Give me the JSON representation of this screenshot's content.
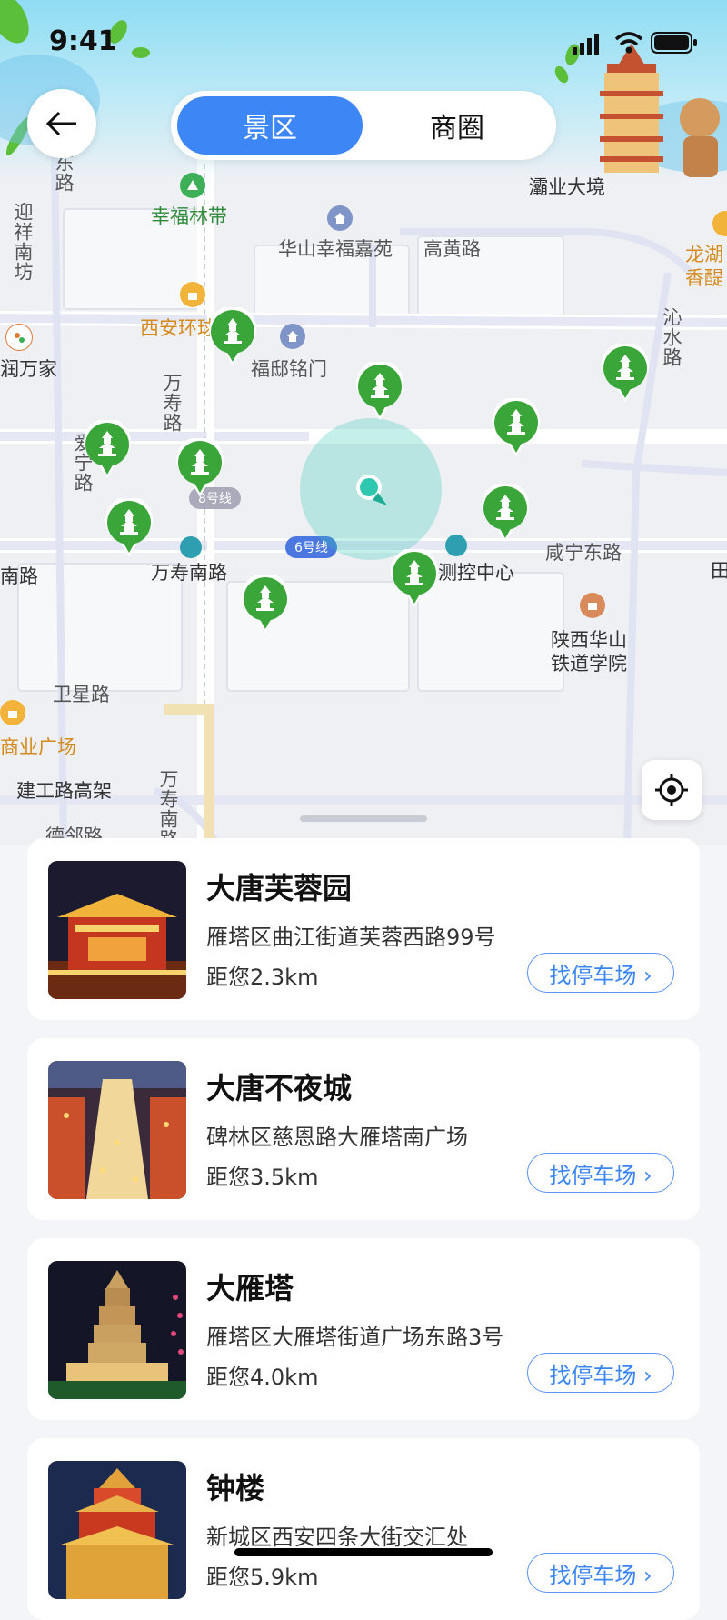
{
  "status": {
    "time": "9:41"
  },
  "tabs": {
    "active": "景区",
    "inactive": "商圈"
  },
  "map": {
    "labels": [
      {
        "text": "幸福林带",
        "cls": "green"
      },
      {
        "text": "华山幸福嘉苑",
        "cls": ""
      },
      {
        "text": "高黄路",
        "cls": ""
      },
      {
        "text": "灞业大境",
        "cls": "dark"
      },
      {
        "text": "龙湖",
        "cls": "orange"
      },
      {
        "text": "香醍",
        "cls": "orange"
      },
      {
        "text": "西安环球",
        "cls": "orange"
      },
      {
        "text": "福邸铭门",
        "cls": ""
      },
      {
        "text": "润万家",
        "cls": "dark"
      },
      {
        "text": "迎祥南坊",
        "cls": ""
      },
      {
        "text": "东路",
        "cls": ""
      },
      {
        "text": "万寿路",
        "cls": ""
      },
      {
        "text": "爱宁路",
        "cls": ""
      },
      {
        "text": "沁水路",
        "cls": ""
      },
      {
        "text": "万寿南路",
        "cls": "dark"
      },
      {
        "text": "测控中心",
        "cls": "dark"
      },
      {
        "text": "咸宁东路",
        "cls": ""
      },
      {
        "text": "陕西华山",
        "cls": "dark"
      },
      {
        "text": "铁道学院",
        "cls": "dark"
      },
      {
        "text": "卫星路",
        "cls": ""
      },
      {
        "text": "商业广场",
        "cls": "orange"
      },
      {
        "text": "建工路高架",
        "cls": "dark"
      },
      {
        "text": "万寿南路",
        "cls": ""
      },
      {
        "text": "德邻路",
        "cls": ""
      },
      {
        "text": "南路",
        "cls": "dark"
      },
      {
        "text": "田",
        "cls": "dark"
      }
    ],
    "metro_line_6": "6号线",
    "metro_line_8": "8号线"
  },
  "scenic_spots": [
    {
      "name": "大唐芙蓉园",
      "address": "雁塔区曲江街道芙蓉西路99号",
      "distance": "距您2.3km",
      "parking": "找停车场 ›"
    },
    {
      "name": "大唐不夜城",
      "address": "碑林区慈恩路大雁塔南广场",
      "distance": "距您3.5km",
      "parking": "找停车场 ›"
    },
    {
      "name": "大雁塔",
      "address": "雁塔区大雁塔街道广场东路3号",
      "distance": "距您4.0km",
      "parking": "找停车场 ›"
    },
    {
      "name": "钟楼",
      "address": "新城区西安四条大街交汇处",
      "distance": "距您5.9km",
      "parking": "找停车场 ›"
    }
  ],
  "colors": {
    "accent": "#3d86f6",
    "pin": "#3aa63a",
    "locator": "#30c7b0"
  }
}
